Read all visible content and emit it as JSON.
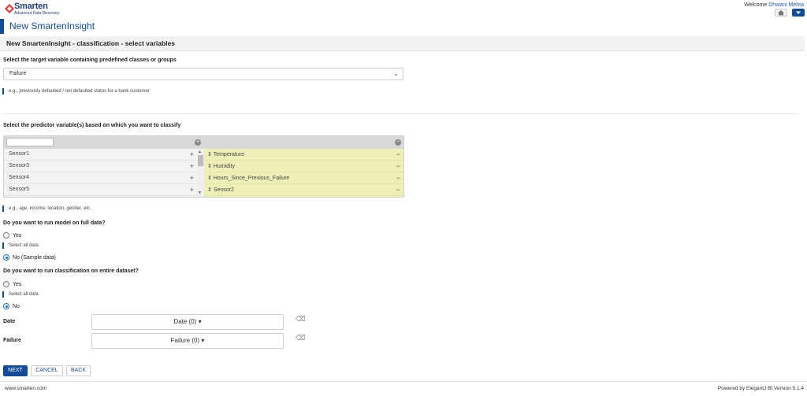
{
  "brand": {
    "name": "Smarten",
    "tagline": "Advanced Data Discovery"
  },
  "header": {
    "welcome_prefix": "Welcome",
    "user_name": "Dhwani Mehta",
    "page_title": "New SmartenInsight"
  },
  "section_title": "New SmartenInsight - classification - select variables",
  "target": {
    "label": "Select the target variable containing predefined classes or groups",
    "selected": "Failure",
    "hint": "e.g., previously defaulted / not defaulted status for a bank customer"
  },
  "predictors": {
    "label": "Select the predictor variable(s) based on which you want to classify",
    "search_value": "",
    "available": [
      "Sensor1",
      "Sensor3",
      "Sensor4",
      "Sensor5"
    ],
    "selected": [
      "Temperature",
      "Humidity",
      "Hours_Since_Previous_Failure",
      "Sensor2"
    ],
    "hint": "e.g., age, income, location, gender, etc."
  },
  "full_data": {
    "question": "Do you want to run model on full data?",
    "yes_label": "Yes",
    "yes_hint": "Select all data",
    "no_label": "No (Sample data)",
    "selected": "no"
  },
  "entire_dataset": {
    "question": "Do you want to run classification on entire dataset?",
    "yes_label": "Yes",
    "yes_hint": "Select all data",
    "no_label": "No",
    "selected": "no"
  },
  "filters": [
    {
      "label": "Date",
      "value": "Date (0)"
    },
    {
      "label": "Failure",
      "value": "Failure (0)"
    }
  ],
  "buttons": {
    "next": "NEXT",
    "cancel": "CANCEL",
    "back": "BACK"
  },
  "footer": {
    "left": "www.smarten.com",
    "right": "Powered by ElegantJ BI Version 5.1.4"
  },
  "colors": {
    "brand_blue": "#0f4c9a",
    "selected_list_bg": "#eef0b8",
    "radio_accent": "#1d6fd6"
  }
}
